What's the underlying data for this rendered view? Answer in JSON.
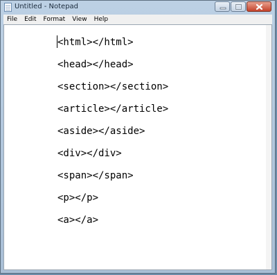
{
  "window": {
    "title": "Untitled - Notepad"
  },
  "menu": [
    "File",
    "Edit",
    "Format",
    "View",
    "Help"
  ],
  "editor": {
    "lines": [
      "<html></html>",
      "<head></head>",
      "<section></section>",
      "<article></article>",
      "<aside></aside>",
      "<div></div>",
      "<span></span>",
      "<p></p>",
      "<a></a>"
    ]
  },
  "colors": {
    "titlebar": "#bcd0e4",
    "close_button": "#c4422b",
    "editor_bg": "#ffffff"
  },
  "icons": [
    "notepad-app-icon",
    "minimize-icon",
    "maximize-icon",
    "close-icon"
  ]
}
